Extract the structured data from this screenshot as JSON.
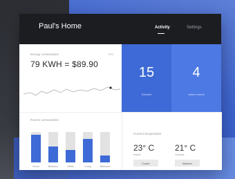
{
  "colors": {
    "accent": "#3d6ad6",
    "accent_light": "#4c79e4",
    "header": "#1c1d21"
  },
  "header": {
    "title": "Paul's Home",
    "subtitle": "",
    "tabs": [
      {
        "label": "Activity",
        "active": true
      },
      {
        "label": "Settings",
        "active": false
      }
    ]
  },
  "energy": {
    "title": "Energy consumption",
    "period": "YTD",
    "value": "79 KWH = $89.90"
  },
  "rooms": {
    "title": "Rooms consumption",
    "items": [
      {
        "label": "Room",
        "value": 0.92
      },
      {
        "label": "Bedroom",
        "value": 0.52
      },
      {
        "label": "Office",
        "value": 0.42
      },
      {
        "label": "Living",
        "value": 0.78
      },
      {
        "label": "Bathroom",
        "value": 0.22
      }
    ]
  },
  "stats": [
    {
      "value": "15",
      "label": "Devices"
    },
    {
      "value": "4",
      "label": "Active rooms"
    }
  ],
  "temperature": {
    "title": "Current temperature",
    "items": [
      {
        "value": "23° C",
        "label": "Inside",
        "button": "Cooler"
      },
      {
        "value": "21° C",
        "label": "Outside",
        "button": "Warmer"
      }
    ]
  }
}
